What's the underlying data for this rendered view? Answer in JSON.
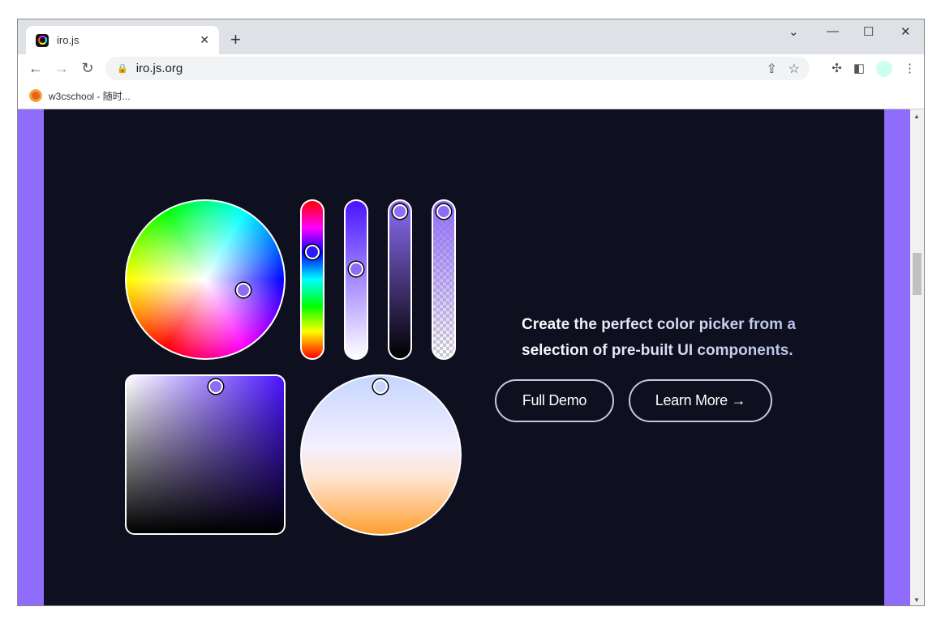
{
  "browser": {
    "tab_title": "iro.js",
    "url": "iro.js.org",
    "bookmark": "w3cschool - 随时...",
    "new_tab": "+",
    "close": "✕"
  },
  "page": {
    "headline": "Create the perfect color picker from a selection of pre-built UI components.",
    "buttons": {
      "full_demo": "Full Demo",
      "learn_more": "Learn More →"
    },
    "colors": {
      "accent": "#8f6cfc",
      "background": "#0e0f1f",
      "selected_color": "#8e6cf5"
    }
  }
}
